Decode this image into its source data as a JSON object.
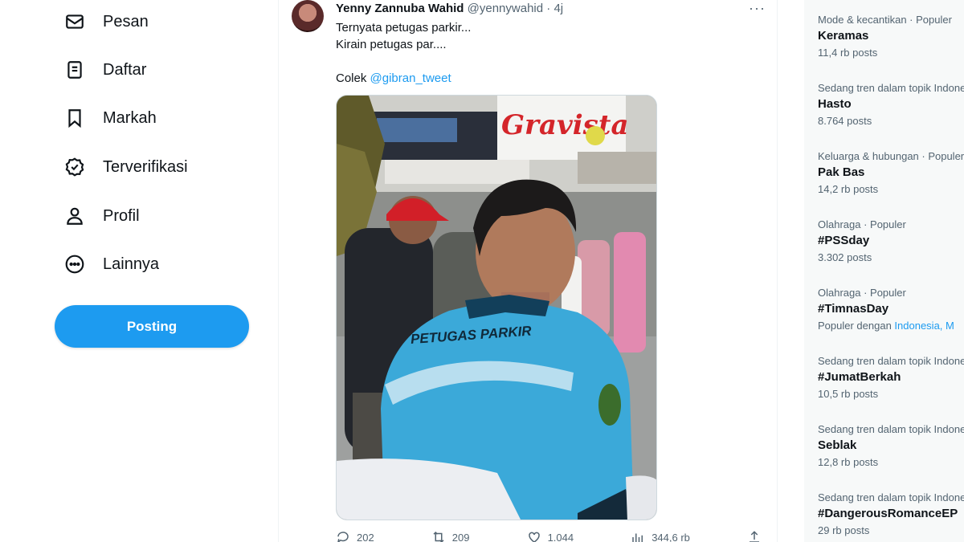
{
  "nav": {
    "items": [
      {
        "label": "Pesan",
        "icon": "envelope-icon"
      },
      {
        "label": "Daftar",
        "icon": "list-icon"
      },
      {
        "label": "Markah",
        "icon": "bookmark-icon"
      },
      {
        "label": "Terverifikasi",
        "icon": "verified-icon"
      },
      {
        "label": "Profil",
        "icon": "person-icon"
      },
      {
        "label": "Lainnya",
        "icon": "more-circle-icon"
      }
    ],
    "post_button": "Posting"
  },
  "tweet": {
    "name": "Yenny Zannuba Wahid",
    "handle": "@yennywahid",
    "separator": "·",
    "time": "4j",
    "more": "···",
    "line1": "Ternyata petugas parkir...",
    "line2": "Kirain petugas par....",
    "line3_prefix": "Colek ",
    "mention": "@gibran_tweet",
    "image": {
      "sign_text": "Gravista",
      "shirt_text": "PETUGAS PARKIR"
    },
    "actions": {
      "replies": "202",
      "reposts": "209",
      "likes": "1.044",
      "views": "344,6 rb"
    }
  },
  "trends": [
    {
      "context": "Mode & kecantikan · Populer",
      "title": "Keramas",
      "count": "11,4 rb posts"
    },
    {
      "context": "Sedang tren dalam topik Indonesia",
      "title": "Hasto",
      "count": "8.764 posts"
    },
    {
      "context": "Keluarga & hubungan · Populer",
      "title": "Pak Bas",
      "count": "14,2 rb posts"
    },
    {
      "context": "Olahraga · Populer",
      "title": "#PSSday",
      "count": "3.302 posts"
    },
    {
      "context": "Olahraga · Populer",
      "title": "#TimnasDay",
      "count_prefix": "Populer dengan ",
      "count_links": "Indonesia, M"
    },
    {
      "context": "Sedang tren dalam topik Indonesia",
      "title": "#JumatBerkah",
      "count": "10,5 rb posts"
    },
    {
      "context": "Sedang tren dalam topik Indonesia",
      "title": "Seblak",
      "count": "12,8 rb posts"
    },
    {
      "context": "Sedang tren dalam topik Indonesia",
      "title": "#DangerousRomanceEP",
      "count": "29 rb posts"
    }
  ],
  "colors": {
    "accent": "#1d9bf0",
    "text": "#0f1419",
    "muted": "#536471",
    "panel": "#f7f9f9"
  }
}
